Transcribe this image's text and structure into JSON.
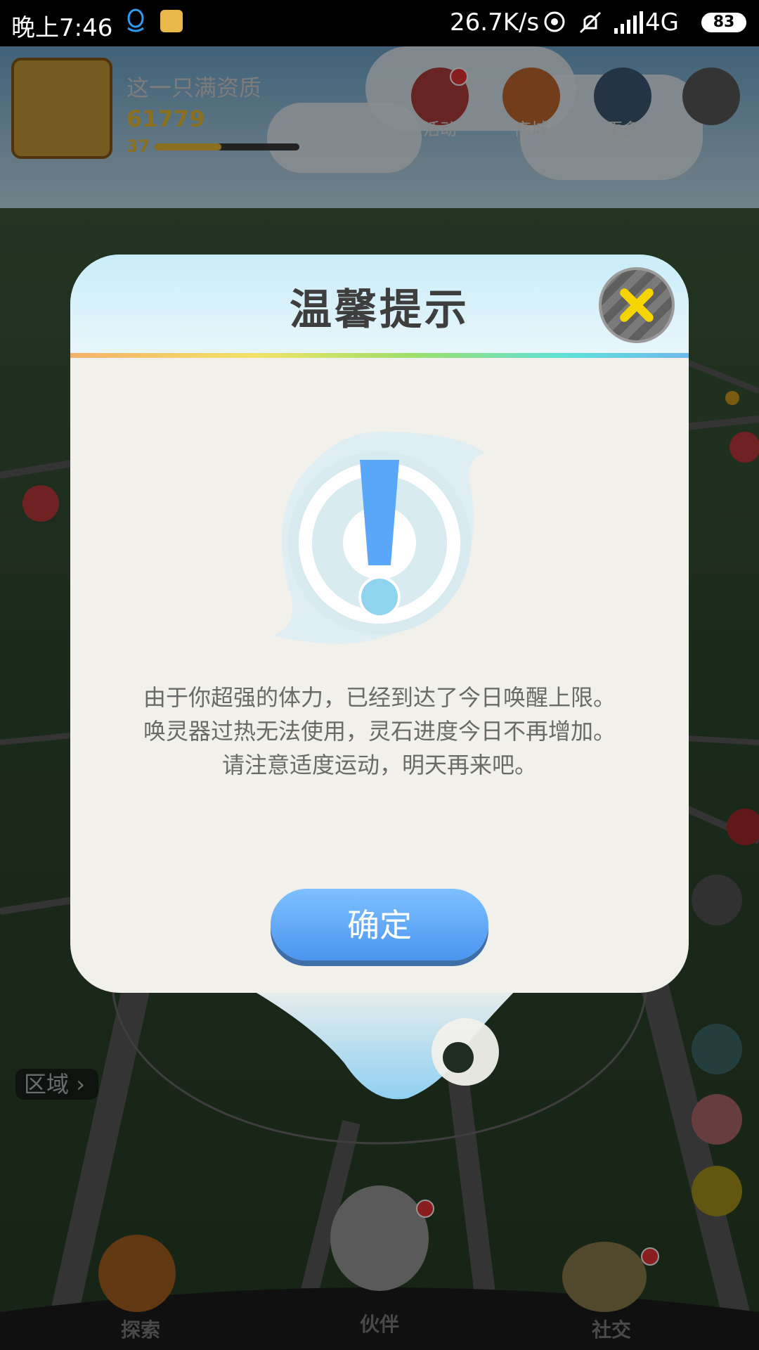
{
  "status_bar": {
    "time": "晚上7:46",
    "speed": "26.7K/s",
    "network": "4G",
    "battery": "83"
  },
  "game": {
    "player": {
      "name": "这一只满资质",
      "score": "61779",
      "level": "37",
      "level_progress": 0.46
    },
    "top_menu": [
      {
        "label": "活动",
        "icon": "gift-icon"
      },
      {
        "label": "商城",
        "icon": "shop-icon"
      },
      {
        "label": "更多",
        "icon": "more-grid-icon"
      }
    ],
    "region_label": "区域",
    "bottom_nav": [
      {
        "label": "探索"
      },
      {
        "label": "伙伴"
      },
      {
        "label": "社交"
      }
    ]
  },
  "dialog": {
    "title": "温馨提示",
    "message_lines": [
      "由于你超强的体力，已经到达了今日唤醒上限。",
      "唤灵器过热无法使用，灵石进度今日不再增加。",
      "请注意适度运动，明天再来吧。"
    ],
    "confirm_label": "确定"
  },
  "colors": {
    "confirm_button": "#5aa6f8",
    "close_icon": "#f5d400",
    "exclamation": "#5aa6f8"
  }
}
